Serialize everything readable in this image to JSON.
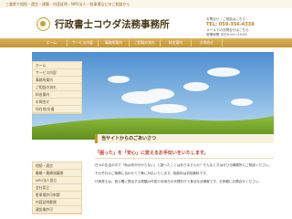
{
  "tagline": "三重県で相続・遺言・建築・内容証明・NPO法人・駐車場などのご相談から",
  "header": {
    "office_name": "行政書士コウダ法務事務所",
    "right_line1": "お問合せ・ご相談はこちら",
    "tel": "TEL: 059-356-4338",
    "right_line2": "メールでのお問合せはこちら",
    "hours": "営業時間 平日9:00〜19:00"
  },
  "nav": [
    "ホーム",
    "サービス内容",
    "事務所案内",
    "ご相談の流れ",
    "料金案内",
    "お問合せ"
  ],
  "sidebar": {
    "upper": [
      "ホーム",
      "サービス内容",
      "事務所案内",
      "ご相談の流れ",
      "料金案内",
      "お問合せ",
      "所在地/交通"
    ],
    "lower": [
      "相続・遺言",
      "離婚・離婚協議書",
      "NPO法人設立",
      "会社設立",
      "駐車場許可申請",
      "内容証明郵便",
      "建設業許可"
    ]
  },
  "content": {
    "section_title": "当サイトからのごあいさつ",
    "lead": "「困った」を「安心」に変えるお手伝いをいたします。",
    "paragraphs": [
      "日々の生活の中で「私は何が分からない」と困ったことはありませんか？そんなときはぜひ当事務所にご相談ください。",
      "それぞれのご事情に合わせて丁寧に対応いたします。相談料は初回無料です。",
      "行政書士は、官公署に提出する書類の作成や手続きの代理を行う身近な法律家です。お気軽にお問合せください。"
    ]
  }
}
